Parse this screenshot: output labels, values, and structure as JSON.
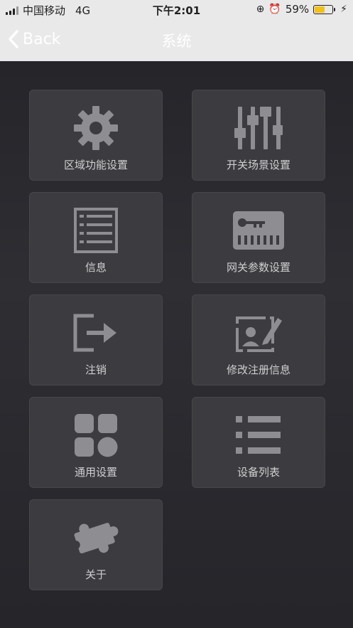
{
  "status_bar": {
    "carrier": "中国移动",
    "network": "4G",
    "time": "下午2:01",
    "battery_percent": "59%",
    "battery_level": 0.59
  },
  "nav": {
    "back_label": "Back",
    "title": "系统"
  },
  "tiles": [
    {
      "label": "区域功能设置",
      "icon": "gear-icon"
    },
    {
      "label": "开关场景设置",
      "icon": "sliders-icon"
    },
    {
      "label": "信息",
      "icon": "list-doc-icon"
    },
    {
      "label": "网关参数设置",
      "icon": "gateway-key-icon"
    },
    {
      "label": "注销",
      "icon": "logout-icon"
    },
    {
      "label": "修改注册信息",
      "icon": "edit-profile-icon"
    },
    {
      "label": "通用设置",
      "icon": "apps-grid-icon"
    },
    {
      "label": "设备列表",
      "icon": "bullet-list-icon"
    },
    {
      "label": "关于",
      "icon": "puzzle-icon"
    }
  ],
  "colors": {
    "header_bg": "#e9e9ea",
    "content_bg": "#2a2a2e",
    "tile_bg": "#3c3c40",
    "icon": "#8e8e92",
    "battery": "#f3c11a"
  }
}
